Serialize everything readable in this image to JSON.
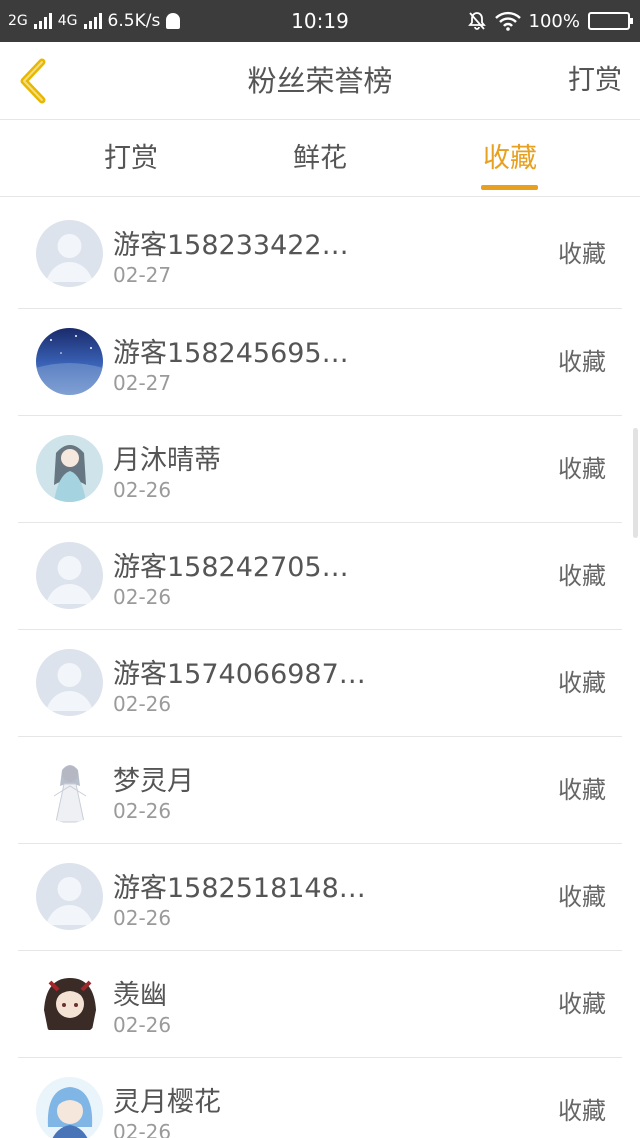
{
  "status_bar": {
    "net_2g": "2G",
    "net_4g": "4G",
    "speed": "6.5K/s",
    "time": "10:19",
    "battery": "100%"
  },
  "nav": {
    "title": "粉丝荣誉榜",
    "action": "打赏"
  },
  "tabs": [
    "打赏",
    "鲜花",
    "收藏"
  ],
  "active_tab": "收藏",
  "colors": {
    "accent": "#e8a020",
    "status_bar_bg": "#3c3c3c"
  },
  "list": [
    {
      "name": "游客158233422…",
      "date": "02-27",
      "action": "收藏",
      "avatar": "default-avatar"
    },
    {
      "name": "游客158245695…",
      "date": "02-27",
      "action": "收藏",
      "avatar": "night-sky-avatar"
    },
    {
      "name": "月沐晴蒂",
      "date": "02-26",
      "action": "收藏",
      "avatar": "anime-girl-avatar"
    },
    {
      "name": "游客158242705…",
      "date": "02-26",
      "action": "收藏",
      "avatar": "default-avatar"
    },
    {
      "name": "游客1574066987…",
      "date": "02-26",
      "action": "收藏",
      "avatar": "default-avatar"
    },
    {
      "name": "梦灵月",
      "date": "02-26",
      "action": "收藏",
      "avatar": "anime-white-dress-avatar"
    },
    {
      "name": "游客1582518148…",
      "date": "02-26",
      "action": "收藏",
      "avatar": "default-avatar"
    },
    {
      "name": "羡幽",
      "date": "02-26",
      "action": "收藏",
      "avatar": "anime-dark-hair-avatar"
    },
    {
      "name": "灵月樱花",
      "date": "02-26",
      "action": "收藏",
      "avatar": "anime-blue-hair-avatar"
    }
  ]
}
